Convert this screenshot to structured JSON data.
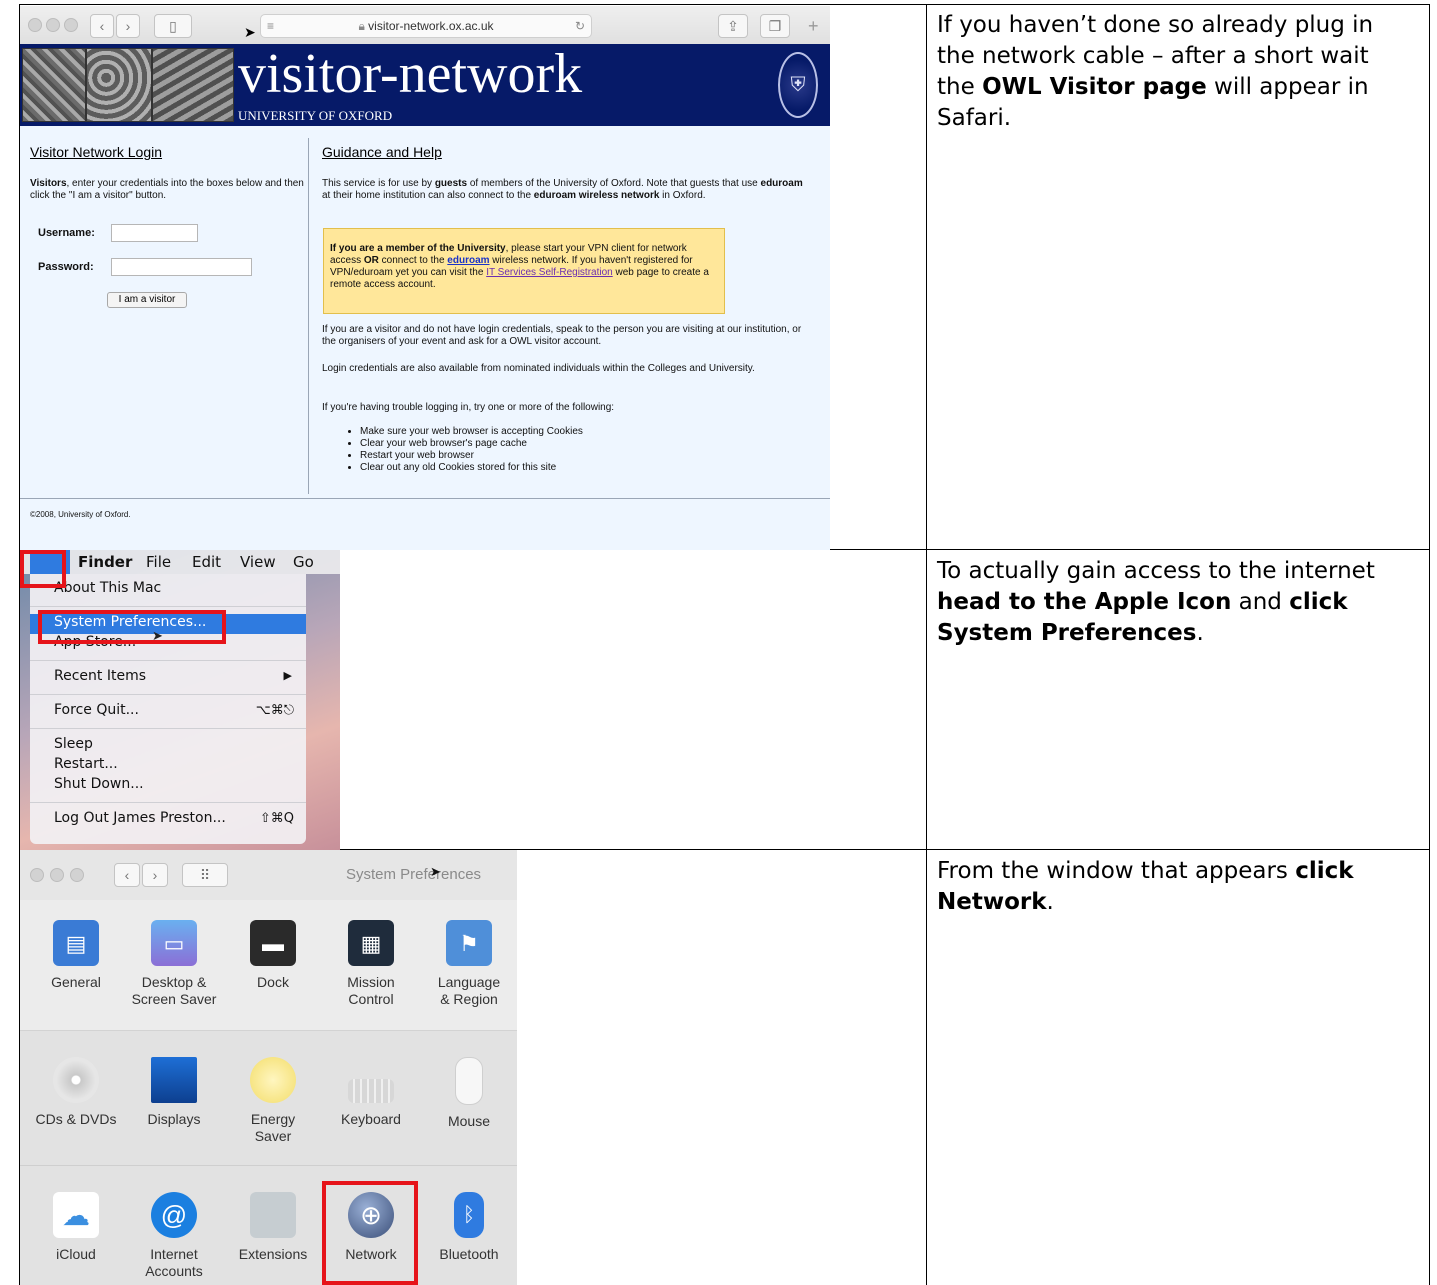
{
  "steps": [
    {
      "prefix": "If you haven’t done so already plug in the network cable – after a short wait the ",
      "bold": "OWL Visitor page",
      "suffix": " will appear in Safari."
    },
    {
      "prefix": "To actually gain access to the internet ",
      "bold1": "head to the Apple Icon",
      "mid": " and ",
      "bold2": "click System Preferences",
      "suffix": "."
    },
    {
      "prefix": "From the window that appears ",
      "bold": "click Network",
      "suffix": "."
    }
  ],
  "safari": {
    "url": "visitor-network.ox.ac.uk",
    "banner_title": "visitor-network",
    "banner_subtitle": "UNIVERSITY OF OXFORD",
    "login": {
      "heading": "Visitor Network Login",
      "intro_bold": "Visitors",
      "intro_rest": ", enter your credentials into the boxes below and then click the \"I am a visitor\" button.",
      "username_label": "Username:",
      "password_label": "Password:",
      "button": "I am a visitor"
    },
    "guidance": {
      "heading": "Guidance and Help",
      "p1_a": "This service is for use by ",
      "p1_b": "guests",
      "p1_c": " of members of the University of Oxford. Note that guests that use ",
      "p1_d": "eduroam",
      "p1_e": " at their home institution can also connect to the ",
      "p1_f": "eduroam wireless network",
      "p1_g": " in Oxford.",
      "notice_a": "If you are a member of the University",
      "notice_b": ", please start your VPN client for network access ",
      "notice_c": "OR",
      "notice_d": " connect to the ",
      "notice_link1": "eduroam",
      "notice_e": " wireless network. If you haven't registered for VPN/eduroam yet you can visit the ",
      "notice_link2": "IT Services Self-Registration",
      "notice_f": " web page to create a remote access account.",
      "p2": "If you are a visitor and do not have login credentials, speak to the person you are visiting at our institution, or the organisers of your event and ask for a OWL visitor account.",
      "p3": "Login credentials are also available from nominated individuals within the Colleges and University.",
      "p4": "If you're having trouble logging in, try one or more of the following:",
      "tips": [
        "Make sure your web browser is accepting Cookies",
        "Clear your web browser's page cache",
        "Restart your web browser",
        "Clear out any old Cookies stored for this site"
      ]
    },
    "footer": "©2008, University of Oxford."
  },
  "apple_menu": {
    "menubar": [
      "Finder",
      "File",
      "Edit",
      "View",
      "Go"
    ],
    "items": {
      "about": "About This Mac",
      "sysprefs": "System Preferences...",
      "appstore": "App Store...",
      "recent": "Recent Items",
      "forcequit": "Force Quit...",
      "forcequit_key": "⌥⌘⎋",
      "sleep": "Sleep",
      "restart": "Restart...",
      "shutdown": "Shut Down...",
      "logout": "Log Out James Preston...",
      "logout_key": "⇧⌘Q"
    }
  },
  "system_preferences": {
    "title": "System Preferences",
    "row1": [
      "General",
      "Desktop &\nScreen Saver",
      "Dock",
      "Mission\nControl",
      "Language\n& Region"
    ],
    "row2": [
      "CDs & DVDs",
      "Displays",
      "Energy\nSaver",
      "Keyboard",
      "Mouse"
    ],
    "row3": [
      "iCloud",
      "Internet\nAccounts",
      "Extensions",
      "Network",
      "Bluetooth"
    ]
  },
  "colors": {
    "highlight_red": "#e6141a",
    "oxford_blue": "#061a68",
    "menu_select": "#2f7be0"
  }
}
